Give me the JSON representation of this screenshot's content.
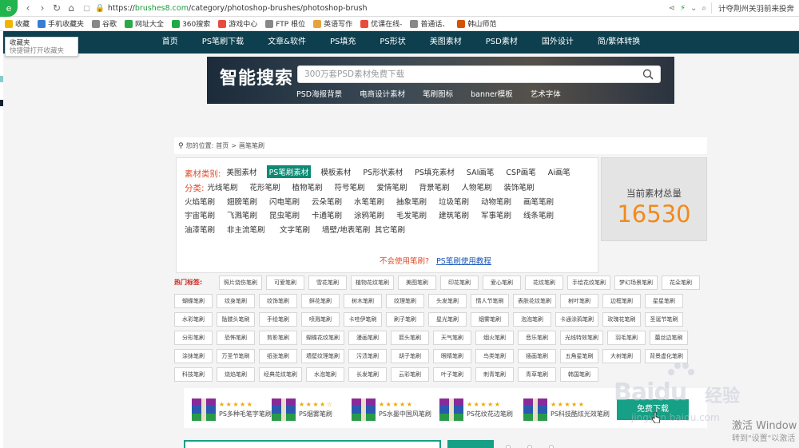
{
  "browser": {
    "url_protocol": "https://",
    "url_host": "brushes8.com",
    "url_path": "/category/photoshop-brushes/photoshop-brush",
    "right_text": "计夺荆州关羽前来投奔"
  },
  "bookmarks": [
    {
      "label": "收藏",
      "color": "#f1b400"
    },
    {
      "label": "手机收藏夹",
      "color": "#3a7bd5"
    },
    {
      "label": "谷歌",
      "color": "#888888"
    },
    {
      "label": "网址大全",
      "color": "#2aa84a"
    },
    {
      "label": "360搜索",
      "color": "#23a846"
    },
    {
      "label": "游戏中心",
      "color": "#e84c3d"
    },
    {
      "label": "FTP 根位",
      "color": "#888888"
    },
    {
      "label": "英语写作",
      "color": "#e6a23c"
    },
    {
      "label": "优课在线-",
      "color": "#e84c3d"
    },
    {
      "label": "普通话、",
      "color": "#888888"
    },
    {
      "label": "韩山师范",
      "color": "#d35400"
    }
  ],
  "fav_popup": {
    "title": "收藏夹",
    "sub": "快捷键打开收藏夹"
  },
  "site_nav": [
    "首页",
    "PS笔刷下载",
    "文章&软件",
    "PS填充",
    "PS形状",
    "美图素材",
    "PSD素材",
    "国外设计",
    "简/繁体转换"
  ],
  "banner": {
    "title": "智能搜索",
    "placeholder": "300万套PSD素材免费下载",
    "links": [
      "PSD海报背景",
      "电商设计素材",
      "笔刷图标",
      "banner模板",
      "艺术字体"
    ]
  },
  "crumb": {
    "prefix": "您的位置:",
    "home": "首页",
    "sep": ">",
    "current": "画笔笔刷"
  },
  "categories": {
    "type_label": "素材类别:",
    "types": [
      "美图素材",
      "PS笔刷素材",
      "模板素材",
      "PS形状素材",
      "PS填充素材",
      "SAI画笔",
      "CSP画笔",
      "Ai画笔"
    ],
    "selected_type": "PS笔刷素材",
    "sub_label": "分类:",
    "rows": [
      [
        "光线笔刷",
        "花形笔刷",
        "植物笔刷",
        "符号笔刷",
        "爱情笔刷",
        "背景笔刷",
        "人物笔刷",
        "装饰笔刷"
      ],
      [
        "火焰笔刷",
        "翅膀笔刷",
        "闪电笔刷",
        "云朵笔刷",
        "水笔笔刷",
        "抽象笔刷",
        "垃圾笔刷",
        "动物笔刷",
        "画笔笔刷"
      ],
      [
        "宇宙笔刷",
        "飞溅笔刷",
        "昆虫笔刷",
        "卡通笔刷",
        "涂鸦笔刷",
        "毛发笔刷",
        "建筑笔刷",
        "军事笔刷",
        "线条笔刷"
      ],
      [
        "油漆笔刷",
        "非主流笔刷",
        "文字笔刷",
        "墙壁/地表笔刷",
        "其它笔刷"
      ]
    ],
    "help_question": "不会使用笔刷?",
    "help_link": "PS笔刷使用教程"
  },
  "count": {
    "label": "当前素材总量",
    "value": "16530"
  },
  "hot_label": "热门标签:",
  "hot_tags": [
    [
      "照片烧伤笔刷",
      "可爱笔刷",
      "雪花笔刷",
      "植物花纹笔刷",
      "美图笔刷",
      "印花笔刷",
      "爱心笔刷",
      "花纹笔刷",
      "手绘花纹笔刷",
      "梦幻场景笔刷",
      "花朵笔刷"
    ],
    [
      "蝴蝶笔刷",
      "纹身笔刷",
      "纹饰笔刷",
      "鲜花笔刷",
      "树木笔刷",
      "纹理笔刷",
      "头发笔刷",
      "情人节笔刷",
      "表肤花纹笔刷",
      "树叶笔刷",
      "边框笔刷",
      "星星笔刷"
    ],
    [
      "水彩笔刷",
      "骷髅头笔刷",
      "手绘笔刷",
      "喷溅笔刷",
      "卡哇伊笔刷",
      "刷子笔刷",
      "星光笔刷",
      "烟雾笔刷",
      "泡泡笔刷",
      "卡通涂鸦笔刷",
      "玫瑰花笔刷",
      "圣诞节笔刷"
    ],
    [
      "分形笔刷",
      "恐怖笔刷",
      "剪影笔刷",
      "蝴蝶花纹笔刷",
      "漫画笔刷",
      "箭头笔刷",
      "天气笔刷",
      "烟火笔刷",
      "音乐笔刷",
      "光线特效笔刷",
      "羽毛笔刷",
      "蕾丝边笔刷"
    ],
    [
      "涂抹笔刷",
      "万圣节笔刷",
      "纸张笔刷",
      "墙壁纹理笔刷",
      "污渍笔刷",
      "胡子笔刷",
      "眼睛笔刷",
      "鸟类笔刷",
      "插画笔刷",
      "五角星笔刷",
      "大树笔刷",
      "背景虚化笔刷"
    ],
    [
      "科技笔刷",
      "烧焰笔刷",
      "经典花纹笔刷",
      "水泡笔刷",
      "长发笔刷",
      "云彩笔刷",
      "叶子笔刷",
      "刺青笔刷",
      "青草笔刷",
      "韩国笔刷"
    ]
  ],
  "recommend": {
    "items": [
      "PS多种毛笔字笔刷",
      "PS烟雾笔刷",
      "PS水墨中国风笔刷",
      "PS花纹花边笔刷",
      "PS科技酷炫光效笔刷"
    ],
    "stars": [
      "★★★★★",
      "★★★★☆",
      "★★★★★",
      "★★★★★",
      "★★★★★"
    ],
    "button": "免费下载"
  },
  "watermark": {
    "brand": "Baidu",
    "jingyan": "经验",
    "url": "jingyan.baidu.com"
  },
  "activate": {
    "line1": "激活 Window",
    "line2": "转到\"设置\"以激活"
  },
  "colors": {
    "nav_bg": "#0d3f4f",
    "accent": "#16a085",
    "count": "#f08a1c",
    "category_label": "#e24b2a"
  }
}
